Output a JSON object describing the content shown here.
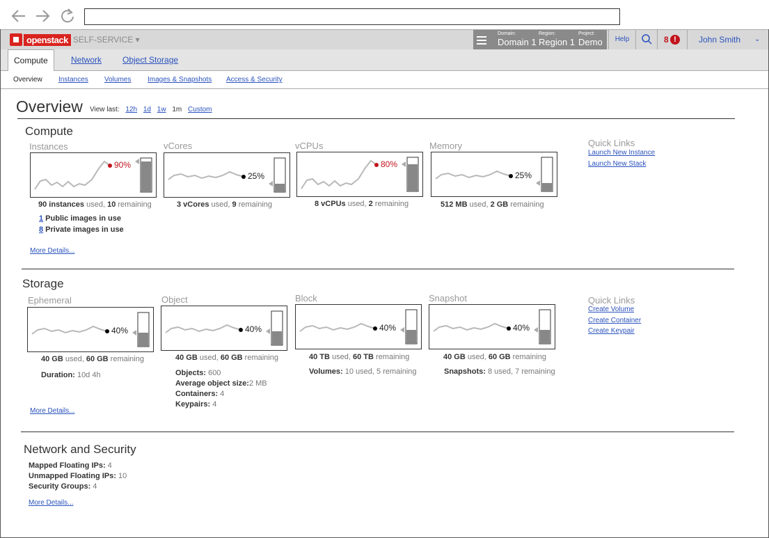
{
  "browser": {
    "url": ""
  },
  "topbar": {
    "logo_text": "openstack",
    "product": "SELF-SERVICE ▾",
    "domain_label": "Domain:",
    "domain_value": "Domain 1",
    "region_label": "Region:",
    "region_value": "Region 1",
    "project_label": "Project:",
    "project_value": "Demo",
    "help": "Help",
    "notifications": "8",
    "notif_badge": "!",
    "user": "John Smith",
    "user_chevron": "⌄"
  },
  "tabs": [
    {
      "label": "Compute",
      "active": true
    },
    {
      "label": "Network",
      "active": false
    },
    {
      "label": "Object Storage",
      "active": false
    }
  ],
  "subtabs": [
    {
      "label": "Overview",
      "active": true
    },
    {
      "label": "Instances",
      "active": false
    },
    {
      "label": "Volumes",
      "active": false
    },
    {
      "label": "Images & Snapshots",
      "active": false
    },
    {
      "label": "Access & Security",
      "active": false
    }
  ],
  "page": {
    "title": "Overview",
    "view_last_label": "View last:",
    "ranges": [
      "12h",
      "1d",
      "1w",
      "1m",
      "Custom"
    ],
    "selected_range": "1m"
  },
  "compute": {
    "title": "Compute",
    "gauges": [
      {
        "label": "Instances",
        "pct": "90%",
        "fill": 0.9,
        "high": true
      },
      {
        "label": "vCores",
        "pct": "25%",
        "fill": 0.25,
        "high": false
      },
      {
        "label": "vCPUs",
        "pct": "80%",
        "fill": 0.8,
        "high": true
      },
      {
        "label": "Memory",
        "pct": "25%",
        "fill": 0.25,
        "high": false
      }
    ],
    "stats": [
      {
        "used": "90 instances",
        "used_suffix": " used, ",
        "rem": "10",
        "rem_suffix": " remaining"
      },
      {
        "used": "3 vCores",
        "used_suffix": " used, ",
        "rem": "9",
        "rem_suffix": " remaining"
      },
      {
        "used": "8 vCPUs",
        "used_suffix": " used, ",
        "rem": "2",
        "rem_suffix": " remaining"
      },
      {
        "used": "512 MB",
        "used_suffix": " used, ",
        "rem": "2 GB",
        "rem_suffix": " remaining"
      }
    ],
    "public_images_num": "1",
    "public_images_label": " Public images in use",
    "private_images_num": "8",
    "private_images_label": " Private images in use",
    "more_details": "More Details...",
    "quick_links_title": "Quick Links",
    "quick_links": [
      "Launch New Instance",
      "Launch New Stack"
    ]
  },
  "storage": {
    "title": "Storage",
    "gauges": [
      {
        "label": "Ephemeral",
        "pct": "40%",
        "fill": 0.4
      },
      {
        "label": "Object",
        "pct": "40%",
        "fill": 0.4
      },
      {
        "label": "Block",
        "pct": "40%",
        "fill": 0.4
      },
      {
        "label": "Snapshot",
        "pct": "40%",
        "fill": 0.4
      }
    ],
    "stats": [
      {
        "used": "40 GB",
        "used_suffix": " used, ",
        "rem": "60 GB",
        "rem_suffix": " remaining"
      },
      {
        "used": "40 GB",
        "used_suffix": " used, ",
        "rem": "60 GB",
        "rem_suffix": " remaining"
      },
      {
        "used": "40 TB",
        "used_suffix": " used, ",
        "rem": "60 TB",
        "rem_suffix": " remaining"
      },
      {
        "used": "40 GB",
        "used_suffix": " used, ",
        "rem": "60 GB",
        "rem_suffix": " remaining"
      }
    ],
    "duration_label": "Duration:",
    "duration_value": " 10d 4h",
    "objects_label": "Objects:",
    "objects_value": " 600",
    "avg_size_label": "Average object size:",
    "avg_size_value": "2 MB",
    "containers_label": "Containers:",
    "containers_value": " 4",
    "keypairs_label": "Keypairs:",
    "keypairs_value": " 4",
    "volumes_label": "Volumes:",
    "volumes_value": " 10 used, 5 remaining",
    "snapshots_label": "Snapshots:",
    "snapshots_value": " 8 used, 7 remaining",
    "more_details": "More Details...",
    "quick_links_title": "Quick Links",
    "quick_links": [
      "Create Volume",
      "Create Container",
      "Create Keypair"
    ]
  },
  "network": {
    "title": "Network and Security",
    "mapped_label": "Mapped Floating IPs:",
    "mapped_value": " 4",
    "unmapped_label": "Unmapped Floating IPs:",
    "unmapped_value": " 10",
    "sg_label": "Security Groups:",
    "sg_value": " 4",
    "more_details": "More Details..."
  },
  "colors": {
    "link": "#2a52be",
    "alert": "#c2141d",
    "brand": "#d9231e",
    "bar": "#888888"
  }
}
